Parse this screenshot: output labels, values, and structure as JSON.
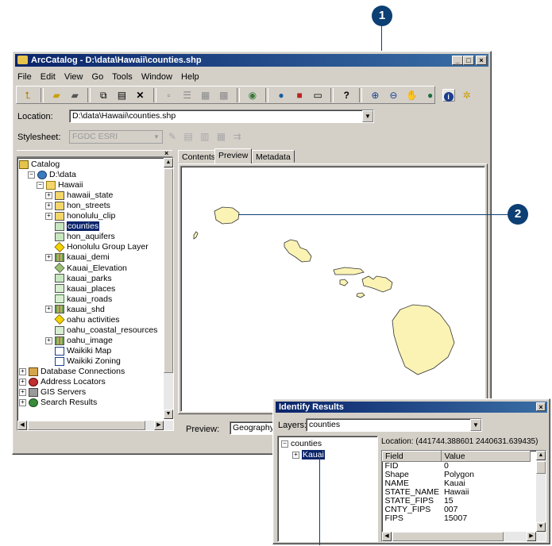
{
  "callouts": {
    "one": "1",
    "two": "2"
  },
  "catalog": {
    "title": "ArcCatalog - D:\\data\\Hawaii\\counties.shp",
    "menu": [
      "File",
      "Edit",
      "View",
      "Go",
      "Tools",
      "Window",
      "Help"
    ],
    "location_label": "Location:",
    "location_value": "D:\\data\\Hawaii\\counties.shp",
    "stylesheet_label": "Stylesheet:",
    "stylesheet_value": "FGDC ESRI",
    "tabs": [
      "Contents",
      "Preview",
      "Metadata"
    ],
    "preview_label": "Preview:",
    "preview_value": "Geography",
    "tree": [
      {
        "label": "Catalog",
        "level": 0,
        "icon": "catalog-icon"
      },
      {
        "label": "D:\\data",
        "level": 1,
        "icon": "drive-icon"
      },
      {
        "label": "Hawaii",
        "level": 2,
        "icon": "folder-icon"
      },
      {
        "label": "hawaii_state",
        "level": 3,
        "icon": "coverage-icon"
      },
      {
        "label": "hon_streets",
        "level": 3,
        "icon": "coverage-icon"
      },
      {
        "label": "honolulu_clip",
        "level": 3,
        "icon": "coverage-icon"
      },
      {
        "label": "counties",
        "level": 3,
        "icon": "polygon-shapefile-icon",
        "selected": true
      },
      {
        "label": "hon_aquifers",
        "level": 3,
        "icon": "polygon-shapefile-icon"
      },
      {
        "label": "Honolulu Group Layer",
        "level": 3,
        "icon": "layer-icon"
      },
      {
        "label": "kauai_demi",
        "level": 3,
        "icon": "raster-icon"
      },
      {
        "label": "Kauai_Elevation",
        "level": 3,
        "icon": "tin-icon"
      },
      {
        "label": "kauai_parks",
        "level": 3,
        "icon": "polygon-shapefile-icon"
      },
      {
        "label": "kauai_places",
        "level": 3,
        "icon": "point-shapefile-icon"
      },
      {
        "label": "kauai_roads",
        "level": 3,
        "icon": "line-shapefile-icon"
      },
      {
        "label": "kauai_shd",
        "level": 3,
        "icon": "raster-icon"
      },
      {
        "label": "oahu activities",
        "level": 3,
        "icon": "layer-icon"
      },
      {
        "label": "oahu_coastal_resources",
        "level": 3,
        "icon": "point-shapefile-icon"
      },
      {
        "label": "oahu_image",
        "level": 3,
        "icon": "raster-icon"
      },
      {
        "label": "Waikiki Map",
        "level": 3,
        "icon": "map-document-icon"
      },
      {
        "label": "Waikiki Zoning",
        "level": 3,
        "icon": "map-document-icon"
      },
      {
        "label": "Database Connections",
        "level": 0,
        "icon": "database-icon"
      },
      {
        "label": "Address Locators",
        "level": 0,
        "icon": "locator-icon"
      },
      {
        "label": "GIS Servers",
        "level": 0,
        "icon": "server-icon"
      },
      {
        "label": "Search Results",
        "level": 0,
        "icon": "search-icon"
      }
    ]
  },
  "identify": {
    "title": "Identify Results",
    "layers_label": "Layers:",
    "layers_value": "counties",
    "tree_root": "counties",
    "tree_child": "Kauai",
    "location": "Location: (441744.388601 2440631.639435)",
    "columns": [
      "Field",
      "Value"
    ],
    "rows": [
      [
        "FID",
        "0"
      ],
      [
        "Shape",
        "Polygon"
      ],
      [
        "NAME",
        "Kauai"
      ],
      [
        "STATE_NAME",
        "Hawaii"
      ],
      [
        "STATE_FIPS",
        "15"
      ],
      [
        "CNTY_FIPS",
        "007"
      ],
      [
        "FIPS",
        "15007"
      ]
    ]
  },
  "colors": {
    "title_bar": "#0a246a",
    "island_fill": "#faf3b4",
    "callout": "#0c3f73"
  }
}
